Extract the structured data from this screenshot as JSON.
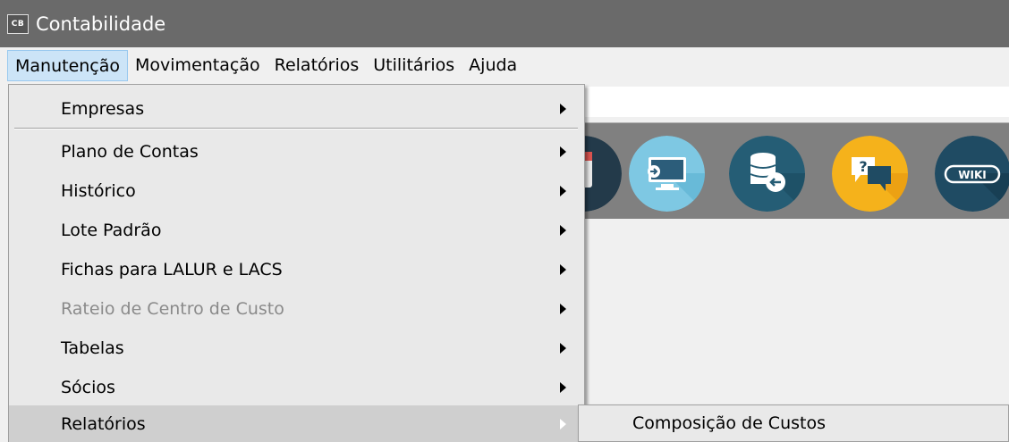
{
  "window": {
    "icon_text": "CB",
    "title": "Contabilidade"
  },
  "menubar": {
    "items": [
      "Manutenção",
      "Movimentação",
      "Relatórios",
      "Utilitários",
      "Ajuda"
    ]
  },
  "dropdown": {
    "items": [
      {
        "label": "Empresas",
        "enabled": true
      },
      {
        "label": "Plano de Contas",
        "enabled": true
      },
      {
        "label": "Histórico",
        "enabled": true
      },
      {
        "label": "Lote Padrão",
        "enabled": true
      },
      {
        "label": "Fichas para LALUR e LACS",
        "enabled": true
      },
      {
        "label": "Rateio de Centro de Custo",
        "enabled": false
      },
      {
        "label": "Tabelas",
        "enabled": true
      },
      {
        "label": "Sócios",
        "enabled": true
      },
      {
        "label": "Relatórios",
        "enabled": true,
        "highlighted": true
      }
    ]
  },
  "submenu": {
    "items": [
      "Composição de Custos"
    ]
  },
  "toolbar": {
    "icons": [
      "calendar-icon",
      "remote-desktop-icon",
      "database-restore-icon",
      "help-chat-icon",
      "wiki-icon"
    ],
    "wiki_label": "WIKI"
  },
  "colors": {
    "titlebar": "#6a6a6a",
    "menu_bg": "#e9e9e9",
    "highlight": "#cfcfcf",
    "disabled_text": "#8a8a8a"
  }
}
